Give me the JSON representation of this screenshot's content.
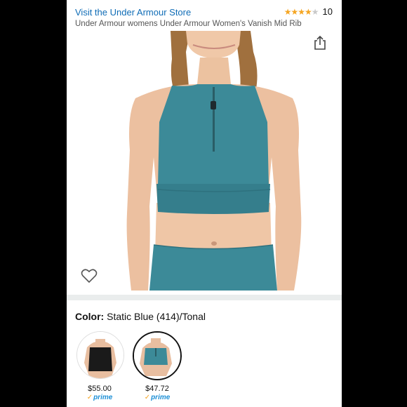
{
  "header": {
    "store_link": "Visit the Under Armour Store",
    "rating_stars": 4,
    "rating_count": "10",
    "title": "Under Armour womens Under Armour Women's Vanish Mid Rib"
  },
  "product": {
    "color_label": "Color:",
    "color_value": "Static Blue (414)/Tonal"
  },
  "variants": [
    {
      "price": "$55.00",
      "prime": "prime",
      "color": "#1a1a1a"
    },
    {
      "price": "$47.72",
      "prime": "prime",
      "color": "#3c8a98"
    }
  ],
  "colors": {
    "link": "#0f6cb6",
    "star": "#f5a623",
    "prime": "#1e90d6",
    "garment": "#3c8a98"
  }
}
